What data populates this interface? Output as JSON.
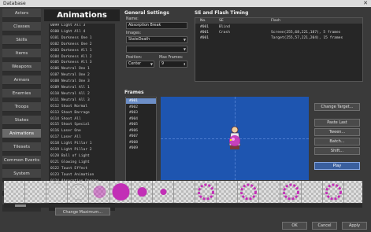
{
  "window": {
    "title": "Database",
    "close_glyph": "✕"
  },
  "categories": [
    "Actors",
    "Classes",
    "Skills",
    "Items",
    "Weapons",
    "Armors",
    "Enemies",
    "Troops",
    "States",
    "Animations",
    "Tilesets",
    "Common Events",
    "System",
    "Types",
    "Terms"
  ],
  "selected_category": "Animations",
  "animations": {
    "header": "Animations",
    "items": [
      "0099 Light All 3",
      "0100 Light All 4",
      "0101 Darkness One 1",
      "0102 Darkness One 2",
      "0103 Darkness All 1",
      "0104 Darkness All 2",
      "0105 Darkness All 3",
      "0106 Neutral One 1",
      "0107 Neutral One 2",
      "0108 Neutral One 3",
      "0109 Neutral All 1",
      "0110 Neutral All 2",
      "0111 Neutral All 3",
      "0112 Shoot Normal",
      "0113 Shoot Barrage",
      "0114 Shoot All",
      "0115 Shoot Special",
      "0116 Laser One",
      "0117 Laser All",
      "0118 Light Pillar 1",
      "0119 Light Pillar 2",
      "0120 Ball of Light",
      "0121 Glowing Light",
      "0122 Taunt Effect",
      "0123 Taunt Animation",
      "0124 Absorption Damage",
      "0125 Absorption Break",
      "0126 BackupMagicLost",
      "0127 BackupSpecialCast"
    ],
    "selected_index": 26,
    "change_max_label": "Change Maximum..."
  },
  "general_settings": {
    "title": "General Settings",
    "name_label": "Name:",
    "name_value": "Absorption Break",
    "images_label": "Images:",
    "image1_value": "StateDeath",
    "image2_value": "",
    "position_label": "Position:",
    "position_value": "Center",
    "max_frames_label": "Max Frames:",
    "max_frames_value": "9"
  },
  "se_flash": {
    "title": "SE and Flash Timing",
    "headers": [
      "No.",
      "SE",
      "Flash"
    ],
    "rows": [
      {
        "no": "#001",
        "se": "Blind",
        "flash": ""
      },
      {
        "no": "#001",
        "se": "Crash",
        "flash": "Screen(255,68,221,187), 5 frames"
      },
      {
        "no": "#001",
        "se": "",
        "flash": "Target(255,57,221,204), 15 frames"
      }
    ]
  },
  "frames": {
    "title": "Frames",
    "items": [
      "#001",
      "#002",
      "#003",
      "#004",
      "#005",
      "#006",
      "#007",
      "#008",
      "#009"
    ],
    "selected_index": 0,
    "buttons": {
      "change_target": "Change Target...",
      "paste_last": "Paste Last",
      "tween": "Tween...",
      "batch": "Batch...",
      "shift": "Shift...",
      "play": "Play"
    }
  },
  "footer": {
    "ok": "OK",
    "cancel": "Cancel",
    "apply": "Apply"
  },
  "colors": {
    "accent": "#6d8fc7",
    "canvas_bg": "#1e55b0",
    "cell_magenta": "#c22fb6"
  }
}
